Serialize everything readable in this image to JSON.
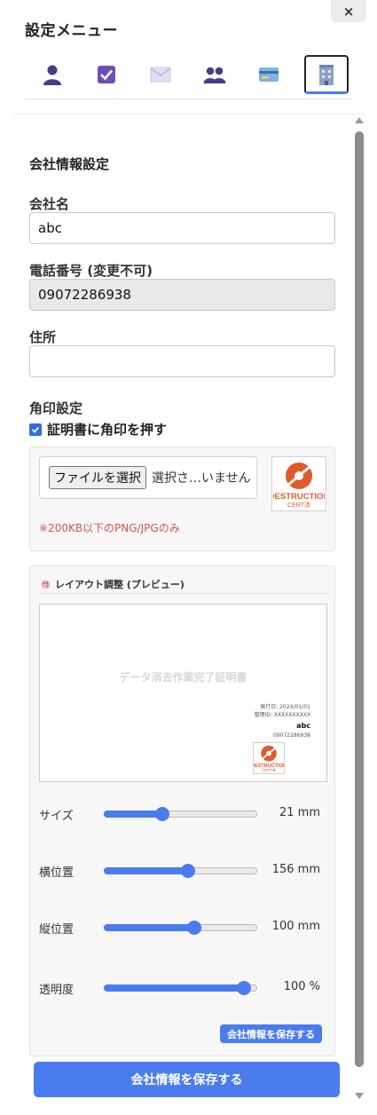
{
  "header": {
    "close_label": "×",
    "title": "設定メニュー"
  },
  "tabs": [
    {
      "icon": "person-icon"
    },
    {
      "icon": "checkbox-icon"
    },
    {
      "icon": "envelope-icon"
    },
    {
      "icon": "people-icon"
    },
    {
      "icon": "credit-card-icon"
    },
    {
      "icon": "office-building-icon",
      "active": true
    }
  ],
  "company": {
    "section_title": "会社情報設定",
    "name_label": "会社名",
    "name_value": "abc",
    "phone_label": "電話番号 (変更不可)",
    "phone_value": "09072286938",
    "address_label": "住所",
    "address_value": ""
  },
  "stamp": {
    "section_label": "角印設定",
    "checkbox_label": "証明書に角印を押す",
    "checked": true,
    "file_button": "ファイルを選択",
    "file_status": "選択さ…いません",
    "note": "※200KB以下のPNG/JPGのみ",
    "image_text_top": "DESTRUCTION",
    "image_text_bottom": "CERT済"
  },
  "layout": {
    "title": "レイアウト調整 (プレビュー)",
    "preview": {
      "doc_title": "データ消去作業完了証明書",
      "issue_date": "発行日: 202X/01/01",
      "manage_id": "管理ID: XXXXXXXXXX",
      "company_name": "abc",
      "phone": "09072286938"
    },
    "sliders": [
      {
        "key": "size",
        "label": "サイズ",
        "value_text": "21 mm",
        "level": 0.38
      },
      {
        "key": "x",
        "label": "横位置",
        "value_text": "156 mm",
        "level": 0.55
      },
      {
        "key": "y",
        "label": "縦位置",
        "value_text": "100 mm",
        "level": 0.59
      },
      {
        "key": "opacity",
        "label": "透明度",
        "value_text": "100 %",
        "level": 0.92
      }
    ],
    "save_small": "会社情報を保存する"
  },
  "footer": {
    "save_button": "会社情報を保存する"
  },
  "colors": {
    "accent": "#4a7cf0",
    "note_red": "#d9534f",
    "stamp_red": "#e05a2b"
  }
}
